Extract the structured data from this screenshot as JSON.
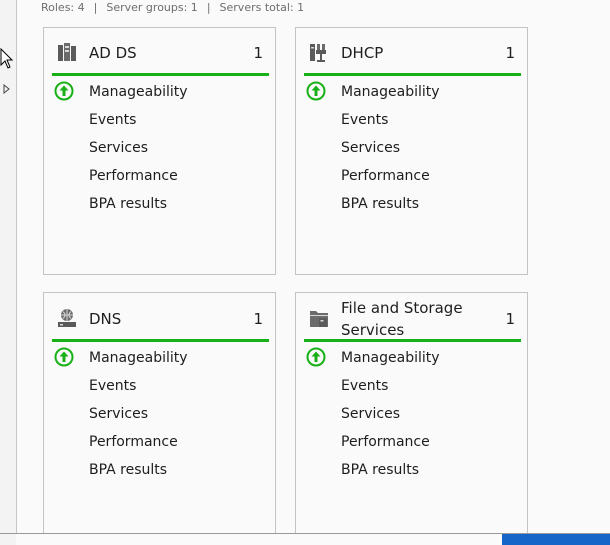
{
  "summary": {
    "roles": "Roles: 4",
    "server_groups": "Server groups: 1",
    "servers_total": "Servers total: 1",
    "separator": "|"
  },
  "colors": {
    "status_green": "#17b017",
    "tile_border": "#c3c3c3",
    "taskbar_accent": "#1565c8"
  },
  "tiles": [
    {
      "title": "AD DS",
      "count": "1",
      "icon": "ad-ds-icon",
      "items": [
        "Manageability",
        "Events",
        "Services",
        "Performance",
        "BPA results"
      ]
    },
    {
      "title": "DHCP",
      "count": "1",
      "icon": "dhcp-icon",
      "items": [
        "Manageability",
        "Events",
        "Services",
        "Performance",
        "BPA results"
      ]
    },
    {
      "title": "DNS",
      "count": "1",
      "icon": "dns-icon",
      "items": [
        "Manageability",
        "Events",
        "Services",
        "Performance",
        "BPA results"
      ]
    },
    {
      "title_line1": "File and Storage",
      "title_line2": "Services",
      "count": "1",
      "icon": "file-storage-icon",
      "items": [
        "Manageability",
        "Events",
        "Services",
        "Performance",
        "BPA results"
      ]
    }
  ]
}
